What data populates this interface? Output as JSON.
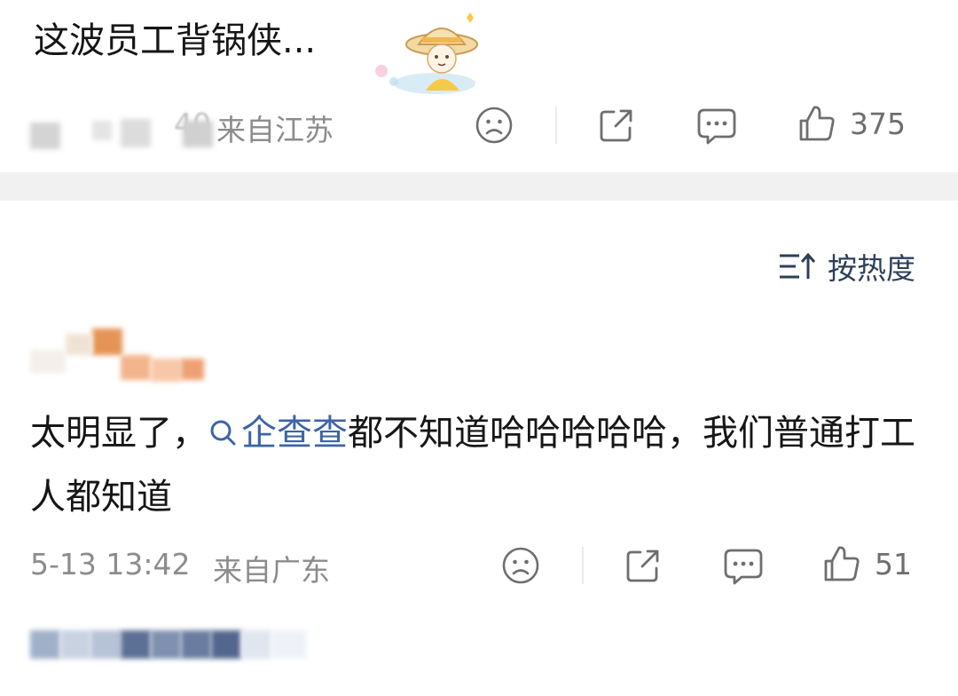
{
  "post": {
    "text": "这波员工背锅侠...",
    "location": "来自江苏",
    "time_fragment": "40",
    "likes": "375"
  },
  "sort": {
    "label": "按热度"
  },
  "comment": {
    "text_before": "太明显了，",
    "mention": "企查查",
    "text_after": "都不知道哈哈哈哈哈，我们普通打工人都知道",
    "time": "5-13 13:42",
    "location": "来自广东",
    "likes": "51"
  },
  "icons": [
    "frown-emoji-icon",
    "share-icon",
    "comment-icon",
    "thumbs-up-icon",
    "sort-icon",
    "search-icon"
  ],
  "colors": {
    "link": "#3e64a6",
    "meta": "#8c8c8c",
    "icon": "#6e6e6e",
    "divider": "#f1f1f1"
  }
}
